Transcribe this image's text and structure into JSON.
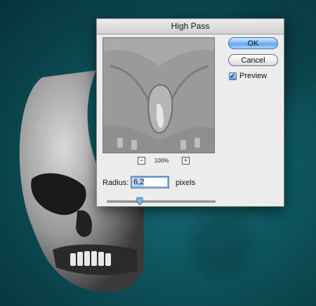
{
  "dialog": {
    "title": "High Pass",
    "ok_label": "OK",
    "cancel_label": "Cancel",
    "preview_label": "Preview",
    "preview_checked": true,
    "zoom_out_icon": "minus-icon",
    "zoom_in_icon": "plus-icon",
    "zoom_text": "100%",
    "radius_label": "Radius:",
    "radius_value": "6,2",
    "units": "pixels",
    "slider_fraction": 0.3
  },
  "colors": {
    "background_teal": "#0f5a63",
    "dialog_bg": "#ececec",
    "default_button_blue": "#5aa2ec"
  }
}
